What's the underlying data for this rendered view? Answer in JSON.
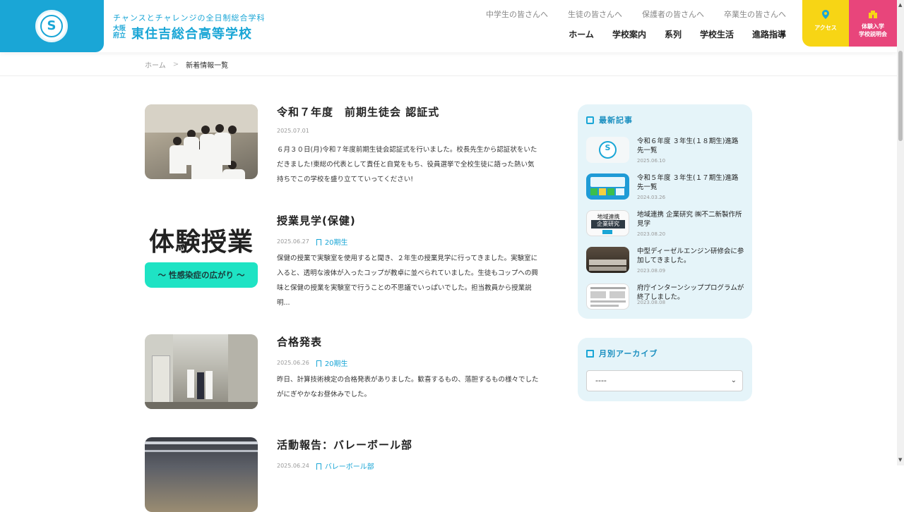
{
  "header": {
    "tagline": "チャンスとチャレンジの全日制総合学科",
    "prefecture": "大阪府立",
    "school_name": "東住吉総合高等学校",
    "subnav": [
      "中学生の皆さんへ",
      "生徒の皆さんへ",
      "保護者の皆さんへ",
      "卒業生の皆さんへ"
    ],
    "mainnav": [
      "ホーム",
      "学校案内",
      "系列",
      "学校生活",
      "進路指導"
    ],
    "access_label": "アクセス",
    "open_label_1": "体験入学",
    "open_label_2": "学校説明会",
    "colors": {
      "brand": "#1aa6d6",
      "access": "#f7d515",
      "open": "#e8457b"
    }
  },
  "breadcrumb": {
    "home": "ホーム",
    "current": "新着情報一覧"
  },
  "posts": [
    {
      "title": "令和７年度　前期生徒会 認証式",
      "date": "2025.07.01",
      "tag": "",
      "excerpt": "６月３０日(月)令和７年度前期生徒会認証式を行いました。校長先生から認証状をいただきました!東総の代表として責任と自覚をもち、役員選挙で全校生徒に語った熱い気持ちでこの学校を盛り立てていってください!"
    },
    {
      "title": "授業見学(保健)",
      "date": "2025.06.27",
      "tag": "20期生",
      "excerpt": "保健の授業で実験室を使用すると聞き、２年生の授業見学に行ってきました。実験室に入ると、透明な液体が入ったコップが教卓に並べられていました。生徒もコップへの興味と保健の授業を実験室で行うことの不思議でいっぱいでした。担当教員から授業説明...",
      "thumb_big": "体験授業",
      "thumb_band": "〜 性感染症の広がり 〜"
    },
    {
      "title": "合格発表",
      "date": "2025.06.26",
      "tag": "20期生",
      "excerpt": "昨日、計算技術検定の合格発表がありました。歓喜するもの、落胆するもの様々でしたがにぎやかなお昼休みでした。"
    },
    {
      "title": "活動報告：バレーボール部",
      "date": "2025.06.24",
      "tag": "バレーボール部",
      "excerpt": ""
    }
  ],
  "sidebar": {
    "recent_heading": "最新記事",
    "recent": [
      {
        "title": "令和６年度 ３年生(１８期生)進路先一覧",
        "date": "2025.06.10"
      },
      {
        "title": "令和５年度 ３年生(１７期生)進路先一覧",
        "date": "2024.03.26"
      },
      {
        "title": "地域連携 企業研究 ㈱不二新製作所見学",
        "date": "2023.08.20",
        "thumb_text_1": "地域連携",
        "thumb_text_2": "企業研究"
      },
      {
        "title": "中型ディーゼルエンジン研修会に参加してきました。",
        "date": "2023.08.09"
      },
      {
        "title": "府庁インターンシッププログラムが終了しました。",
        "date": "2023.08.08"
      }
    ],
    "archive_heading": "月別アーカイブ",
    "archive_select_value": "----"
  }
}
